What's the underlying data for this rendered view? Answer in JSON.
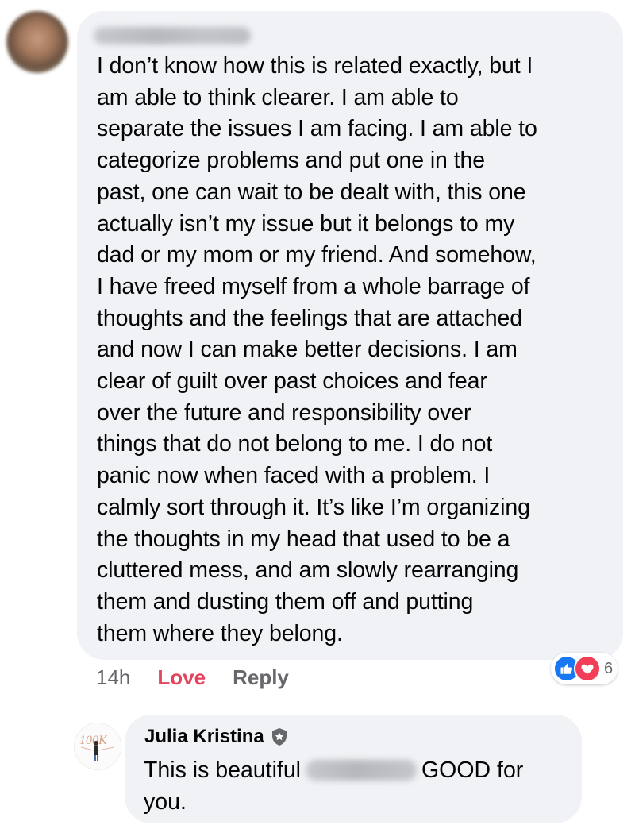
{
  "comment": {
    "text": "I don’t know how this is related exactly, but I\nam able to think clearer. I am able to\nseparate the issues I am facing. I am able to\ncategorize problems and put one in the\npast, one can wait to be dealt with, this one\nactually isn’t my issue but it belongs to my\ndad or my mom or my friend. And somehow,\nI have freed myself from a whole barrage of\nthoughts and the feelings that are attached\nand now I can make better decisions. I am\nclear of guilt over past choices and fear\nover the future and responsibility over\nthings that do not belong to me. I do not\npanic now when faced with a problem.  I\ncalmly sort through it. It’s like I’m organizing\nthe thoughts in my head that used to be a\ncluttered mess, and am slowly rearranging\nthem and dusting them off and putting\nthem where they belong.",
    "time": "14h",
    "love_label": "Love",
    "reply_label": "Reply",
    "reaction_count": "6",
    "reaction_icons": [
      "like-icon",
      "love-icon"
    ]
  },
  "reply": {
    "author": "Julia Kristina",
    "badge_icon": "shield-icon",
    "text_before": "This is beautiful",
    "text_after": "GOOD for you."
  },
  "colors": {
    "bubble_bg": "#f0f2f5",
    "love_red": "#e2445c",
    "like_blue": "#1877f2",
    "heart_red": "#f33e58",
    "meta_gray": "#65676b"
  }
}
